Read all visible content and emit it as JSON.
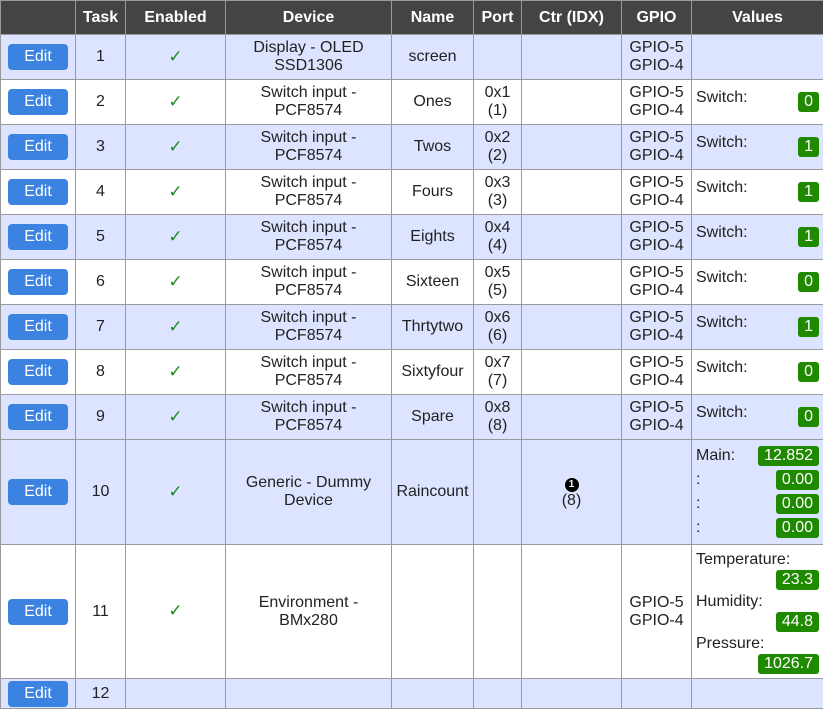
{
  "headers": {
    "edit": "",
    "task": "Task",
    "enabled": "Enabled",
    "device": "Device",
    "name": "Name",
    "port": "Port",
    "ctr": "Ctr (IDX)",
    "gpio": "GPIO",
    "values": "Values"
  },
  "edit_label": "Edit",
  "check_glyph": "✓",
  "colors": {
    "edit_button": "#3c82e0",
    "badge": "#1f8a00",
    "header_bg": "#444444",
    "row_alt_bg": "#dde4ff",
    "check": "#1e8a1e"
  },
  "rows": [
    {
      "task": "1",
      "device1": "Display - OLED",
      "device2": "SSD1306",
      "name": "screen",
      "port1": "",
      "port2": "",
      "gpio1": "GPIO-5",
      "gpio2": "GPIO-4",
      "val_label": "",
      "val": ""
    },
    {
      "task": "2",
      "device1": "Switch input -",
      "device2": "PCF8574",
      "name": "Ones",
      "port1": "0x1",
      "port2": "(1)",
      "gpio1": "GPIO-5",
      "gpio2": "GPIO-4",
      "val_label": "Switch:",
      "val": "0"
    },
    {
      "task": "3",
      "device1": "Switch input -",
      "device2": "PCF8574",
      "name": "Twos",
      "port1": "0x2",
      "port2": "(2)",
      "gpio1": "GPIO-5",
      "gpio2": "GPIO-4",
      "val_label": "Switch:",
      "val": "1"
    },
    {
      "task": "4",
      "device1": "Switch input -",
      "device2": "PCF8574",
      "name": "Fours",
      "port1": "0x3",
      "port2": "(3)",
      "gpio1": "GPIO-5",
      "gpio2": "GPIO-4",
      "val_label": "Switch:",
      "val": "1"
    },
    {
      "task": "5",
      "device1": "Switch input -",
      "device2": "PCF8574",
      "name": "Eights",
      "port1": "0x4",
      "port2": "(4)",
      "gpio1": "GPIO-5",
      "gpio2": "GPIO-4",
      "val_label": "Switch:",
      "val": "1"
    },
    {
      "task": "6",
      "device1": "Switch input -",
      "device2": "PCF8574",
      "name": "Sixteen",
      "port1": "0x5",
      "port2": "(5)",
      "gpio1": "GPIO-5",
      "gpio2": "GPIO-4",
      "val_label": "Switch:",
      "val": "0"
    },
    {
      "task": "7",
      "device1": "Switch input -",
      "device2": "PCF8574",
      "name": "Thrtytwo",
      "port1": "0x6",
      "port2": "(6)",
      "gpio1": "GPIO-5",
      "gpio2": "GPIO-4",
      "val_label": "Switch:",
      "val": "1"
    },
    {
      "task": "8",
      "device1": "Switch input -",
      "device2": "PCF8574",
      "name": "Sixtyfour",
      "port1": "0x7",
      "port2": "(7)",
      "gpio1": "GPIO-5",
      "gpio2": "GPIO-4",
      "val_label": "Switch:",
      "val": "0"
    },
    {
      "task": "9",
      "device1": "Switch input -",
      "device2": "PCF8574",
      "name": "Spare",
      "port1": "0x8",
      "port2": "(8)",
      "gpio1": "GPIO-5",
      "gpio2": "GPIO-4",
      "val_label": "Switch:",
      "val": "0"
    }
  ],
  "dummy": {
    "task": "10",
    "device1": "Generic - Dummy",
    "device2": "Device",
    "name": "Raincount",
    "ctr_icon": "1",
    "ctr_idx": "(8)",
    "values": [
      {
        "label": "Main:",
        "val": "12.852"
      },
      {
        "label": ":",
        "val": "0.00"
      },
      {
        "label": ":",
        "val": "0.00"
      },
      {
        "label": ":",
        "val": "0.00"
      }
    ]
  },
  "env": {
    "task": "11",
    "device1": "Environment -",
    "device2": "BMx280",
    "gpio1": "GPIO-5",
    "gpio2": "GPIO-4",
    "values": [
      {
        "label": "Temperature:",
        "val": "23.3"
      },
      {
        "label": "Humidity:",
        "val": "44.8"
      },
      {
        "label": "Pressure:",
        "val": "1026.7"
      }
    ]
  },
  "last": {
    "task": "12"
  }
}
